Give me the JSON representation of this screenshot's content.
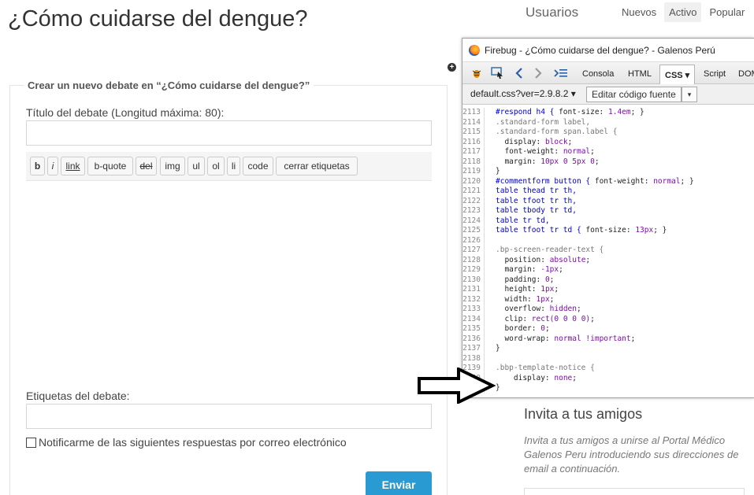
{
  "page": {
    "title": "¿Cómo cuidarse del dengue?"
  },
  "topnav": {
    "section_title": "Usuarios",
    "tabs": [
      {
        "label": "Nuevos",
        "active": false
      },
      {
        "label": "Activo",
        "active": true
      },
      {
        "label": "Popular",
        "active": false
      }
    ]
  },
  "form": {
    "legend": "Crear un nuevo debate en “¿Cómo cuidarse del dengue?”",
    "title_label": "Título del debate (Longitud máxima: 80):",
    "title_value": "",
    "toolbar": [
      "b",
      "i",
      "link",
      "b-quote",
      "del",
      "img",
      "ul",
      "ol",
      "li",
      "code",
      "cerrar etiquetas"
    ],
    "tags_label": "Etiquetas del debate:",
    "tags_value": "",
    "notify_label": "Notificarme de las siguientes respuestas por correo electrónico",
    "notify_checked": false,
    "submit_label": "Enviar"
  },
  "invite": {
    "title": "Invita a tus amigos",
    "text": "Invita a tus amigos a unirse al Portal Médico Galenos Peru introduciendo sus direcciones de email a continuación."
  },
  "firebug": {
    "window_title": "Firebug - ¿Cómo cuidarse del dengue? - Galenos Perú",
    "tabs": [
      {
        "label": "Consola",
        "active": false
      },
      {
        "label": "HTML",
        "active": false
      },
      {
        "label": "CSS ▾",
        "active": true
      },
      {
        "label": "Script",
        "active": false
      },
      {
        "label": "DOM",
        "active": false
      }
    ],
    "file": "default.css?ver=2.9.8.2 ▾",
    "edit_button": "Editar código fuente",
    "dropdown_symbol": "▾",
    "code_lines": [
      {
        "n": "2113",
        "t": "#respond h4 { font-size: 1.4em; }"
      },
      {
        "n": "2114",
        "t": ".standard-form label,"
      },
      {
        "n": "2115",
        "t": ".standard-form span.label {"
      },
      {
        "n": "2116",
        "t": "  display: block;"
      },
      {
        "n": "2117",
        "t": "  font-weight: normal;"
      },
      {
        "n": "2118",
        "t": "  margin: 10px 0 5px 0;"
      },
      {
        "n": "2119",
        "t": "}"
      },
      {
        "n": "2120",
        "t": "#commentform button { font-weight: normal; }"
      },
      {
        "n": "2121",
        "t": "table thead tr th,"
      },
      {
        "n": "2122",
        "t": "table tfoot tr th,"
      },
      {
        "n": "2123",
        "t": "table tbody tr td,"
      },
      {
        "n": "2124",
        "t": "table tr td,"
      },
      {
        "n": "2125",
        "t": "table tfoot tr td { font-size: 13px; }"
      },
      {
        "n": "2126",
        "t": ""
      },
      {
        "n": "2127",
        "t": ".bp-screen-reader-text {"
      },
      {
        "n": "2128",
        "t": "  position: absolute;"
      },
      {
        "n": "2129",
        "t": "  margin: -1px;"
      },
      {
        "n": "2130",
        "t": "  padding: 0;"
      },
      {
        "n": "2131",
        "t": "  height: 1px;"
      },
      {
        "n": "2132",
        "t": "  width: 1px;"
      },
      {
        "n": "2133",
        "t": "  overflow: hidden;"
      },
      {
        "n": "2134",
        "t": "  clip: rect(0 0 0 0);"
      },
      {
        "n": "2135",
        "t": "  border: 0;"
      },
      {
        "n": "2136",
        "t": "  word-wrap: normal !important;"
      },
      {
        "n": "2137",
        "t": "}"
      },
      {
        "n": "2138",
        "t": ""
      },
      {
        "n": "2139",
        "t": ".bbp-template-notice {"
      },
      {
        "n": "2140",
        "t": "    display: none;"
      },
      {
        "n": "2141",
        "t": "}"
      }
    ]
  },
  "colors": {
    "submit_bg": "#2a9ad2",
    "selector": "#0000c0",
    "value": "#7a0ea8"
  }
}
